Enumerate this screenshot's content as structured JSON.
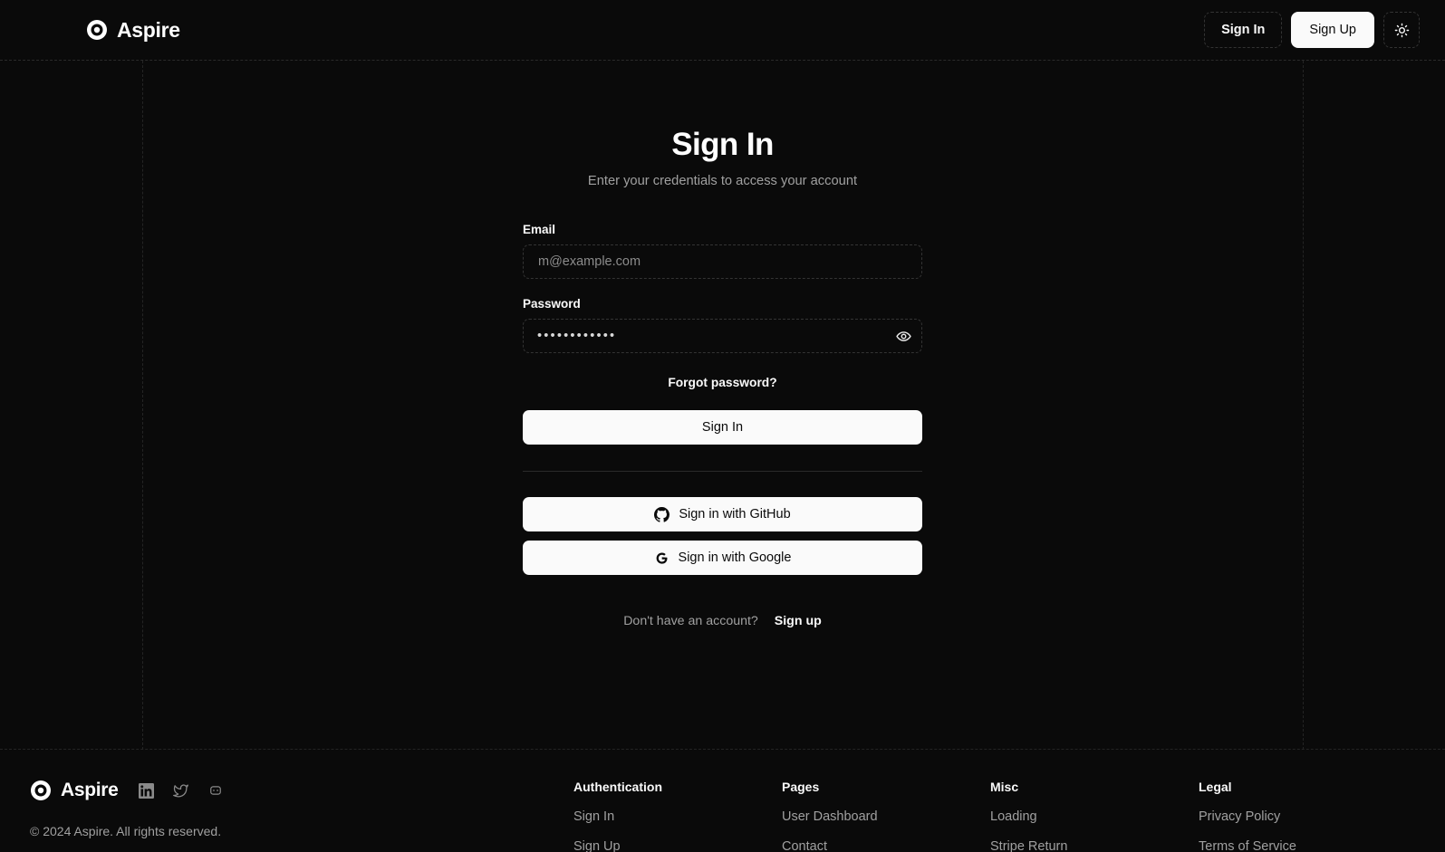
{
  "header": {
    "brand": "Aspire",
    "logo_icon": "bullseye-icon",
    "sign_in_label": "Sign In",
    "sign_up_label": "Sign Up",
    "theme_toggle_icon": "sun-icon"
  },
  "auth": {
    "title": "Sign In",
    "subtitle": "Enter your credentials to access your account",
    "email_label": "Email",
    "email_placeholder": "m@example.com",
    "email_value": "",
    "password_label": "Password",
    "password_value": "••••••••••••",
    "password_toggle_icon": "eye-icon",
    "forgot_label": "Forgot password?",
    "submit_label": "Sign In",
    "oauth": [
      {
        "label": "Sign in with GitHub",
        "icon": "github-icon"
      },
      {
        "label": "Sign in with Google",
        "icon": "google-icon"
      }
    ],
    "signup_prompt": "Don't have an account?",
    "signup_link": "Sign up"
  },
  "footer": {
    "brand": "Aspire",
    "logo_icon": "bullseye-icon",
    "socials": [
      {
        "name": "linkedin-icon"
      },
      {
        "name": "twitter-icon"
      },
      {
        "name": "discord-icon"
      }
    ],
    "copyright": "© 2024 Aspire. All rights reserved.",
    "columns": [
      {
        "title": "Authentication",
        "links": [
          "Sign In",
          "Sign Up"
        ]
      },
      {
        "title": "Pages",
        "links": [
          "User Dashboard",
          "Contact"
        ]
      },
      {
        "title": "Misc",
        "links": [
          "Loading",
          "Stripe Return"
        ]
      },
      {
        "title": "Legal",
        "links": [
          "Privacy Policy",
          "Terms of Service"
        ]
      }
    ]
  },
  "colors": {
    "background": "#0a0a0a",
    "foreground": "#fafafa",
    "muted": "#a0a0a0",
    "border_dashed": "#333333"
  }
}
